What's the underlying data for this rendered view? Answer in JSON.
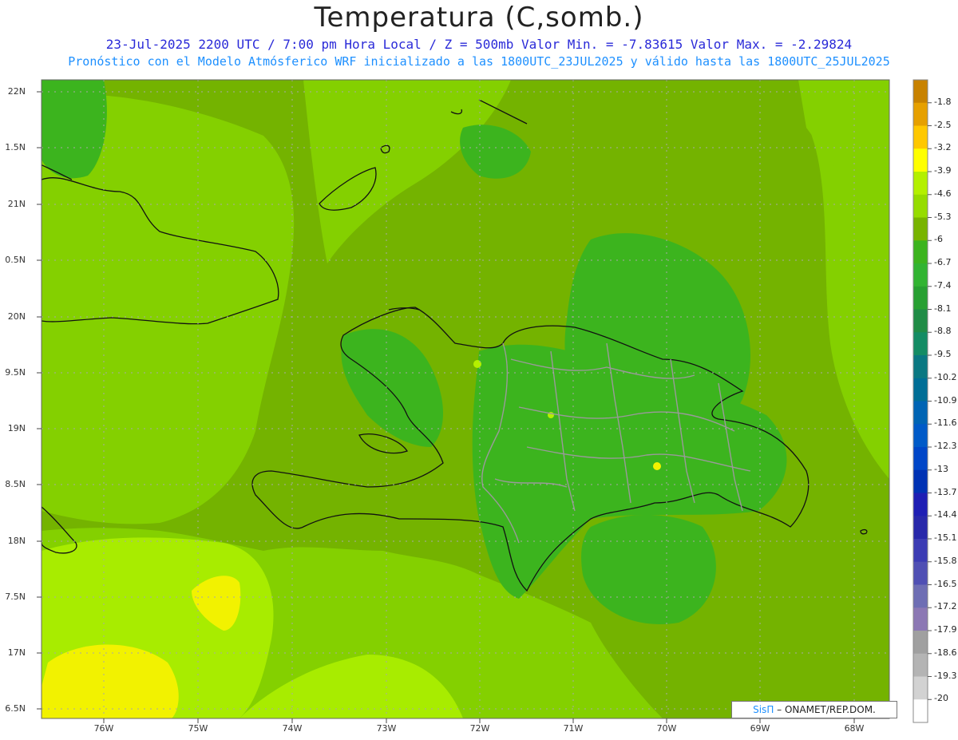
{
  "header": {
    "title": "Temperatura (C,somb.)",
    "subtitle_line1": "23-Jul-2025  2200 UTC / 7:00 pm Hora Local / Z = 500mb  Valor Min. = -7.83615  Valor Max. = -2.29824",
    "subtitle_line2": "Pronóstico con el Modelo Atmósferico WRF inicializado a las 1800UTC_23JUL2025 y válido hasta las  1800UTC_25JUL2025"
  },
  "map": {
    "lat_labels": [
      "22N",
      "1.5N",
      "21N",
      "0.5N",
      "20N",
      "9.5N",
      "19N",
      "8.5N",
      "18N",
      "7.5N",
      "17N",
      "6.5N"
    ],
    "lon_labels": [
      "76W",
      "75W",
      "74W",
      "73W",
      "72W",
      "71W",
      "70W",
      "69W",
      "68W"
    ],
    "background_color": "#84d000"
  },
  "colorbar": {
    "labels": [
      "-1.8",
      "-2.5",
      "-3.2",
      "-3.9",
      "-4.6",
      "-5.3",
      "-6",
      "-6.7",
      "-7.4",
      "-8.1",
      "-8.8",
      "-9.5",
      "-10.2",
      "-10.9",
      "-11.6",
      "-12.3",
      "-13",
      "-13.7",
      "-14.4",
      "-15.1",
      "-15.8",
      "-16.5",
      "-17.2",
      "-17.9",
      "-18.6",
      "-19.3",
      "-20"
    ],
    "colors": [
      "#c88200",
      "#e6a000",
      "#ffc800",
      "#ffff00",
      "#b4f000",
      "#96dc00",
      "#78b400",
      "#3cb41e",
      "#32b432",
      "#28a032",
      "#208c46",
      "#148c64",
      "#0a7882",
      "#006e96",
      "#0064b4",
      "#005ac8",
      "#0046c8",
      "#0032b4",
      "#1e1eb4",
      "#2828aa",
      "#3c3cb4",
      "#5050b4",
      "#6e6eb4",
      "#8c78b4",
      "#a0a0a0",
      "#b4b4b4",
      "#d2d2d2",
      "#ffffff"
    ]
  },
  "footer": {
    "credit_brand": "SisΠ",
    "credit_text": " – ONAMET/REP.DOM."
  }
}
